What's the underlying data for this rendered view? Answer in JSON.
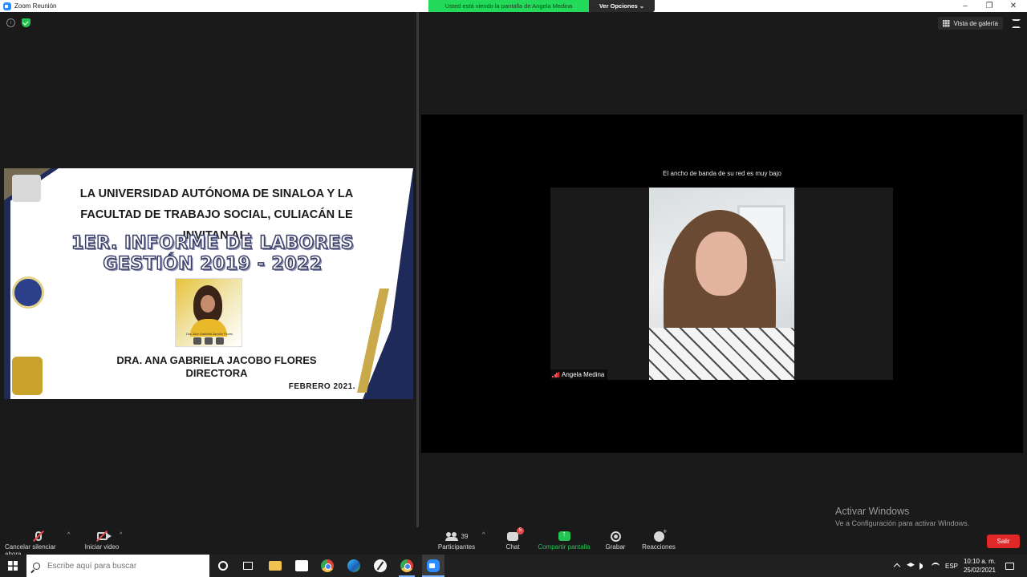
{
  "window": {
    "title": "Zoom Reunión",
    "sharing_banner": "Usted está viendo la pantalla de Angela Medina",
    "view_options": "Ver Opciones ⌄"
  },
  "slide": {
    "line1": "LA UNIVERSIDAD AUTÓNOMA DE SINALOA Y LA",
    "line2": "FACULTAD DE TRABAJO SOCIAL, CULIACÁN LE",
    "line3": "INVITAN AL:",
    "big1": "1ER. INFORME DE LABORES",
    "big2": "GESTIÓN 2019 - 2022",
    "photo_caption": "Dra. Ana Gabriela Jacobo Flores",
    "name": "DRA. ANA GABRIELA JACOBO FLORES",
    "role": "DIRECTORA",
    "date": "FEBRERO 2021."
  },
  "video": {
    "gallery_label": "Vista de galería",
    "bandwidth_warning": "El ancho de banda de su red es muy bajo",
    "participant_name": "Angela Medina"
  },
  "watermark": {
    "title": "Activar Windows",
    "subtitle": "Ve a Configuración para activar Windows."
  },
  "toolbar": {
    "unmute": "Cancelar silenciar ahora",
    "start_video": "Iniciar video",
    "participants": "Participantes",
    "participants_count": "39",
    "chat": "Chat",
    "chat_badge": "5",
    "share": "Compartir pantalla",
    "record": "Grabar",
    "reactions": "Reacciones",
    "leave": "Salir"
  },
  "taskbar": {
    "search_placeholder": "Escribe aquí para buscar",
    "language": "ESP",
    "time": "10:10 a. m.",
    "date": "25/02/2021"
  },
  "colors": {
    "share_green": "#23c552",
    "banner_green": "#23d959",
    "leave_red": "#e02828",
    "navy": "#1e2a5a",
    "gold": "#c9a94a"
  }
}
